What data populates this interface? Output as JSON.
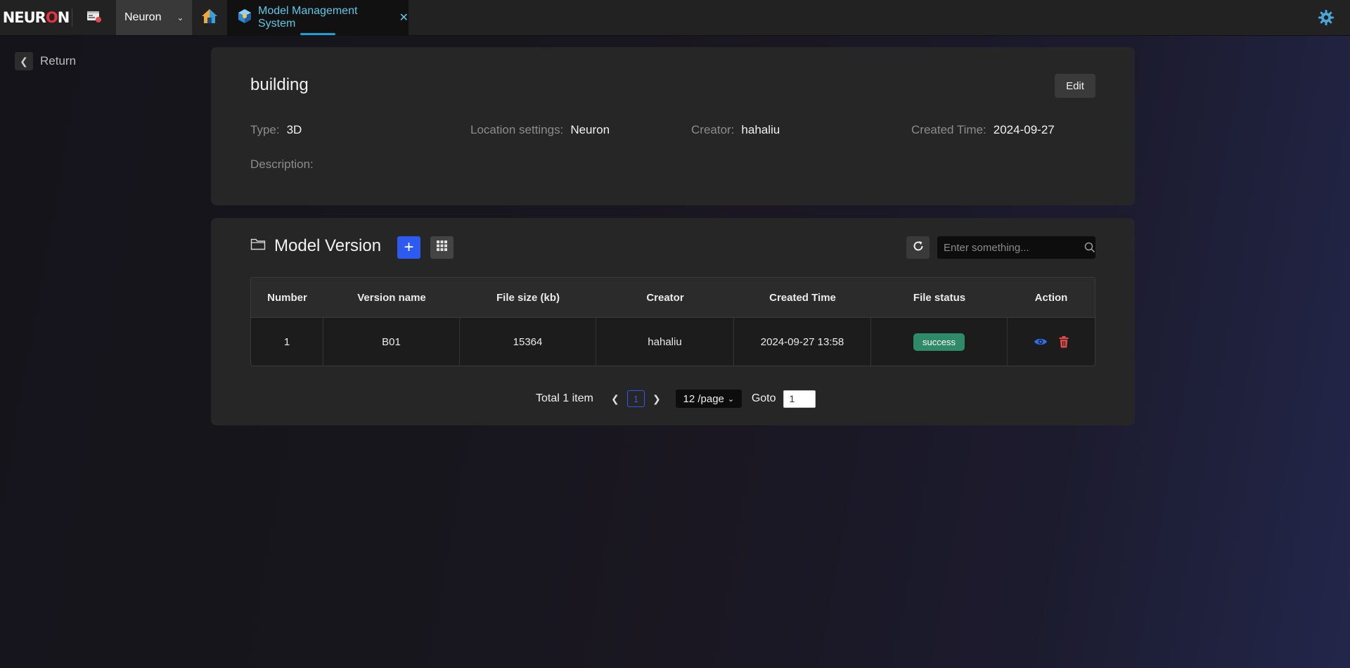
{
  "topbar": {
    "logo": {
      "pre": "NEUR",
      "o": "O",
      "post": "N"
    },
    "tabs": [
      {
        "label": "Neuron"
      },
      {
        "label": "Model Management System"
      }
    ]
  },
  "return_label": "Return",
  "model": {
    "name": "building",
    "edit_label": "Edit",
    "fields": {
      "type": {
        "label": "Type:",
        "value": "3D"
      },
      "location": {
        "label": "Location settings:",
        "value": "Neuron"
      },
      "creator": {
        "label": "Creator:",
        "value": "hahaliu"
      },
      "created": {
        "label": "Created Time:",
        "value": "2024-09-27"
      }
    },
    "description_label": "Description:"
  },
  "versions": {
    "title": "Model Version",
    "search_placeholder": "Enter something...",
    "columns": [
      "Number",
      "Version name",
      "File size  (kb)",
      "Creator",
      "Created Time",
      "File status",
      "Action"
    ],
    "rows": [
      {
        "number": "1",
        "version": "B01",
        "size": "15364",
        "creator": "hahaliu",
        "created": "2024-09-27 13:58",
        "status": "success"
      }
    ],
    "pagination": {
      "total": "Total 1 item",
      "current": "1",
      "per_page": "12 /page",
      "goto_label": "Goto",
      "goto_value": "1"
    }
  },
  "colors": {
    "accent_blue": "#2d5bf0",
    "tab_active_text": "#5ec8e6",
    "success_badge": "#2f8a6a",
    "delete_red": "#e04a4a"
  }
}
